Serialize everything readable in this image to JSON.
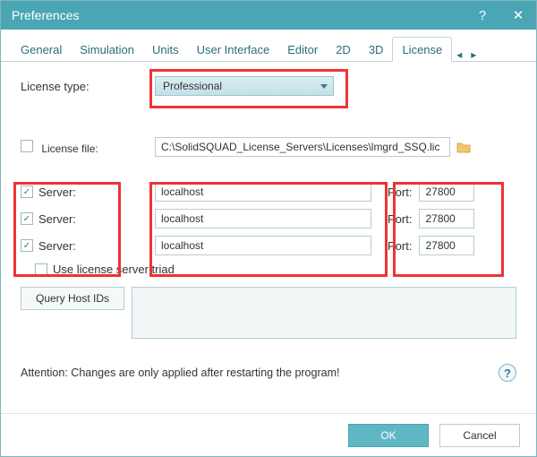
{
  "window": {
    "title": "Preferences"
  },
  "tabs": {
    "items": [
      "General",
      "Simulation",
      "Units",
      "User Interface",
      "Editor",
      "2D",
      "3D",
      "License"
    ],
    "active": "License"
  },
  "license": {
    "type_label": "License type:",
    "type_value": "Professional",
    "file_label": "License file:",
    "file_value": "C:\\SolidSQUAD_License_Servers\\Licenses\\lmgrd_SSQ.lic",
    "servers": [
      {
        "label": "Server:",
        "checked": true,
        "host": "localhost",
        "port_label": "Port:",
        "port": "27800"
      },
      {
        "label": "Server:",
        "checked": true,
        "host": "localhost",
        "port_label": "Port:",
        "port": "27800"
      },
      {
        "label": "Server:",
        "checked": true,
        "host": "localhost",
        "port_label": "Port:",
        "port": "27800"
      }
    ],
    "triad_label": "Use license server triad",
    "triad_checked": false,
    "query_button": "Query Host IDs",
    "attention": "Attention: Changes are only applied after restarting the program!"
  },
  "footer": {
    "ok": "OK",
    "cancel": "Cancel"
  }
}
